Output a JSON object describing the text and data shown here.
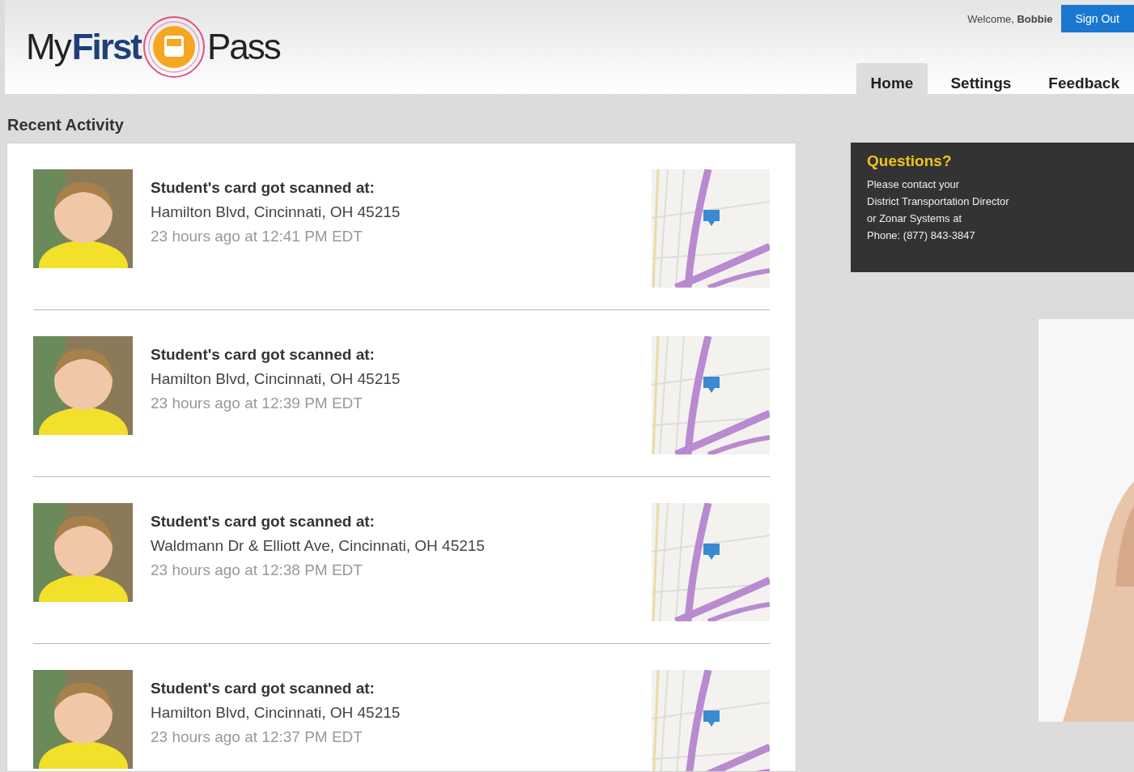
{
  "logo": {
    "part_1": "My",
    "part_2": "First",
    "part_3": "Pass"
  },
  "header": {
    "welcome": "Welcome,",
    "user": "Bobbie",
    "sign_out": "Sign Out"
  },
  "tabs": [
    {
      "label": "Home",
      "selected": true
    },
    {
      "label": "Settings",
      "selected": false
    },
    {
      "label": "Feedback",
      "selected": false
    }
  ],
  "section_title": "Recent Activity",
  "activity": [
    {
      "title": "Student's card got scanned at:",
      "address": "Hamilton Blvd, Cincinnati, OH 45215",
      "time": "23 hours ago at 12:41 PM EDT"
    },
    {
      "title": "Student's card got scanned at:",
      "address": "Hamilton Blvd, Cincinnati, OH 45215",
      "time": "23 hours ago at 12:39 PM EDT"
    },
    {
      "title": "Student's card got scanned at:",
      "address": "Waldmann Dr & Elliott Ave, Cincinnati, OH 45215",
      "time": "23 hours ago at 12:38 PM EDT"
    },
    {
      "title": "Student's card got scanned at:",
      "address": "Hamilton Blvd, Cincinnati, OH 45215",
      "time": "23 hours ago at 12:37 PM EDT"
    }
  ],
  "questions": {
    "title": "Questions?",
    "lines": [
      "Please contact your",
      "District Transportation Director",
      "or Zonar Systems at",
      "Phone: (877) 843-3847"
    ]
  }
}
